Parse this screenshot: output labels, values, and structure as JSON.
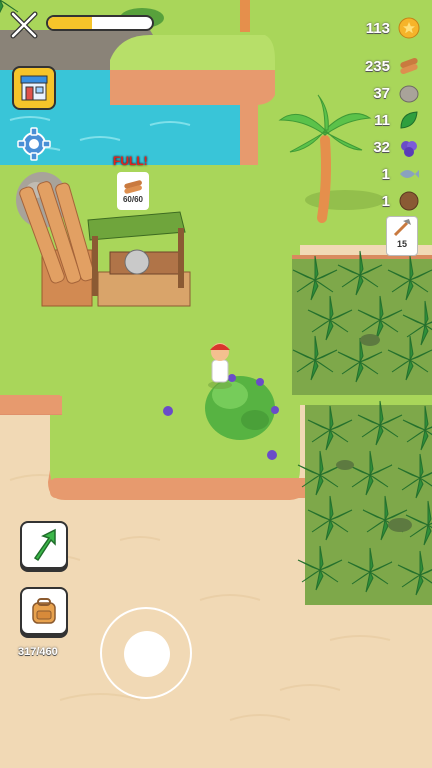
{
  "hud": {
    "xp_bar_fill": 0.42,
    "resources": [
      {
        "icon": "coin-icon",
        "value": "113"
      },
      {
        "icon": "wood-log-icon",
        "value": "235"
      },
      {
        "icon": "stone-icon",
        "value": "37"
      },
      {
        "icon": "leaf-icon",
        "value": "11"
      },
      {
        "icon": "berries-icon",
        "value": "32"
      },
      {
        "icon": "fish-icon",
        "value": "1"
      },
      {
        "icon": "coconut-icon",
        "value": "1"
      }
    ],
    "tool_badge": {
      "icon": "tool-icon",
      "value": "15"
    }
  },
  "sawmill": {
    "status_label": "FULL!",
    "capacity_text": "60/60"
  },
  "inventory": {
    "capacity_text": "317/460"
  },
  "colors": {
    "grass": "#a9d65a",
    "water": "#39c5d8",
    "sand": "#f1d9b5",
    "cliff": "#e79a6e",
    "leaf": "#2f8f3a",
    "accent_yellow": "#f6c42a"
  }
}
